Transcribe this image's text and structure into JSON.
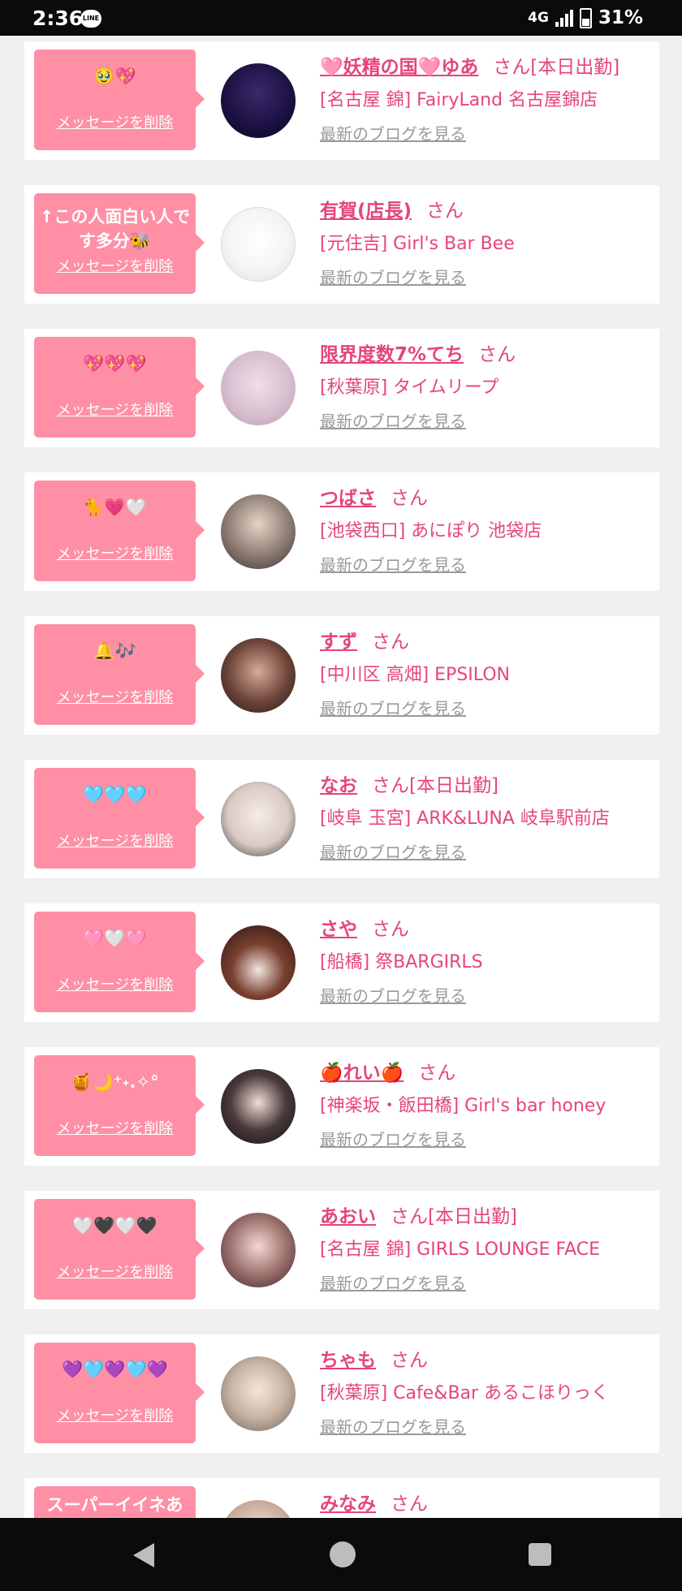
{
  "status": {
    "time": "2:36",
    "network": "4G",
    "battery": "31%",
    "line_icon": "LINE"
  },
  "actions": {
    "delete": "メッセージを削除",
    "blog": "最新のブログを見る",
    "honorific": "さん"
  },
  "colors": {
    "accent_pink": "#fe8fa5",
    "link_pink": "#e5457a",
    "bar": "#0b0b0b"
  },
  "cards": [
    {
      "message": "🥹💖",
      "name": "🩷妖精の国🩷ゆあ",
      "tag": "[本日出勤]",
      "shop": "[名古屋 錦] FairyLand 名古屋錦店"
    },
    {
      "message": "↑この人面白い人です多分🐝",
      "name": "有賀(店長)",
      "tag": "",
      "shop": "[元住吉] Girl's Bar Bee"
    },
    {
      "message": "💖💖💖",
      "name": "限界度数7%てち",
      "tag": "",
      "shop": "[秋葉原] タイムリープ"
    },
    {
      "message": "🐈💗🤍",
      "name": "つばさ",
      "tag": "",
      "shop": "[池袋西口] あにぽり 池袋店"
    },
    {
      "message": "🔔🎶",
      "name": "すず",
      "tag": "",
      "shop": "[中川区 高畑] EPSILON"
    },
    {
      "message": "🩵🩵🩵",
      "name": "なお",
      "tag": "[本日出勤]",
      "shop": "[岐阜 玉宮] ARK&LUNA 岐阜駅前店"
    },
    {
      "message": "🩷🤍🩷",
      "name": "さや",
      "tag": "",
      "shop": "[船橋] 祭BARGIRLS"
    },
    {
      "message": "🍯🌙⁺˖.✧°",
      "name": "🍎れい🍎",
      "tag": "",
      "shop": "[神楽坂・飯田橋] Girl's bar honey"
    },
    {
      "message": "🤍🖤🤍🖤",
      "name": "あおい",
      "tag": "[本日出勤]",
      "shop": "[名古屋 錦] GIRLS LOUNGE FACE"
    },
    {
      "message": "💜🩵💜🩵💜",
      "name": "ちゃも",
      "tag": "",
      "shop": "[秋葉原] Cafe&Bar あるこほりっく"
    },
    {
      "message": "スーパーイイネあ",
      "name": "みなみ",
      "tag": "",
      "shop": ""
    }
  ]
}
